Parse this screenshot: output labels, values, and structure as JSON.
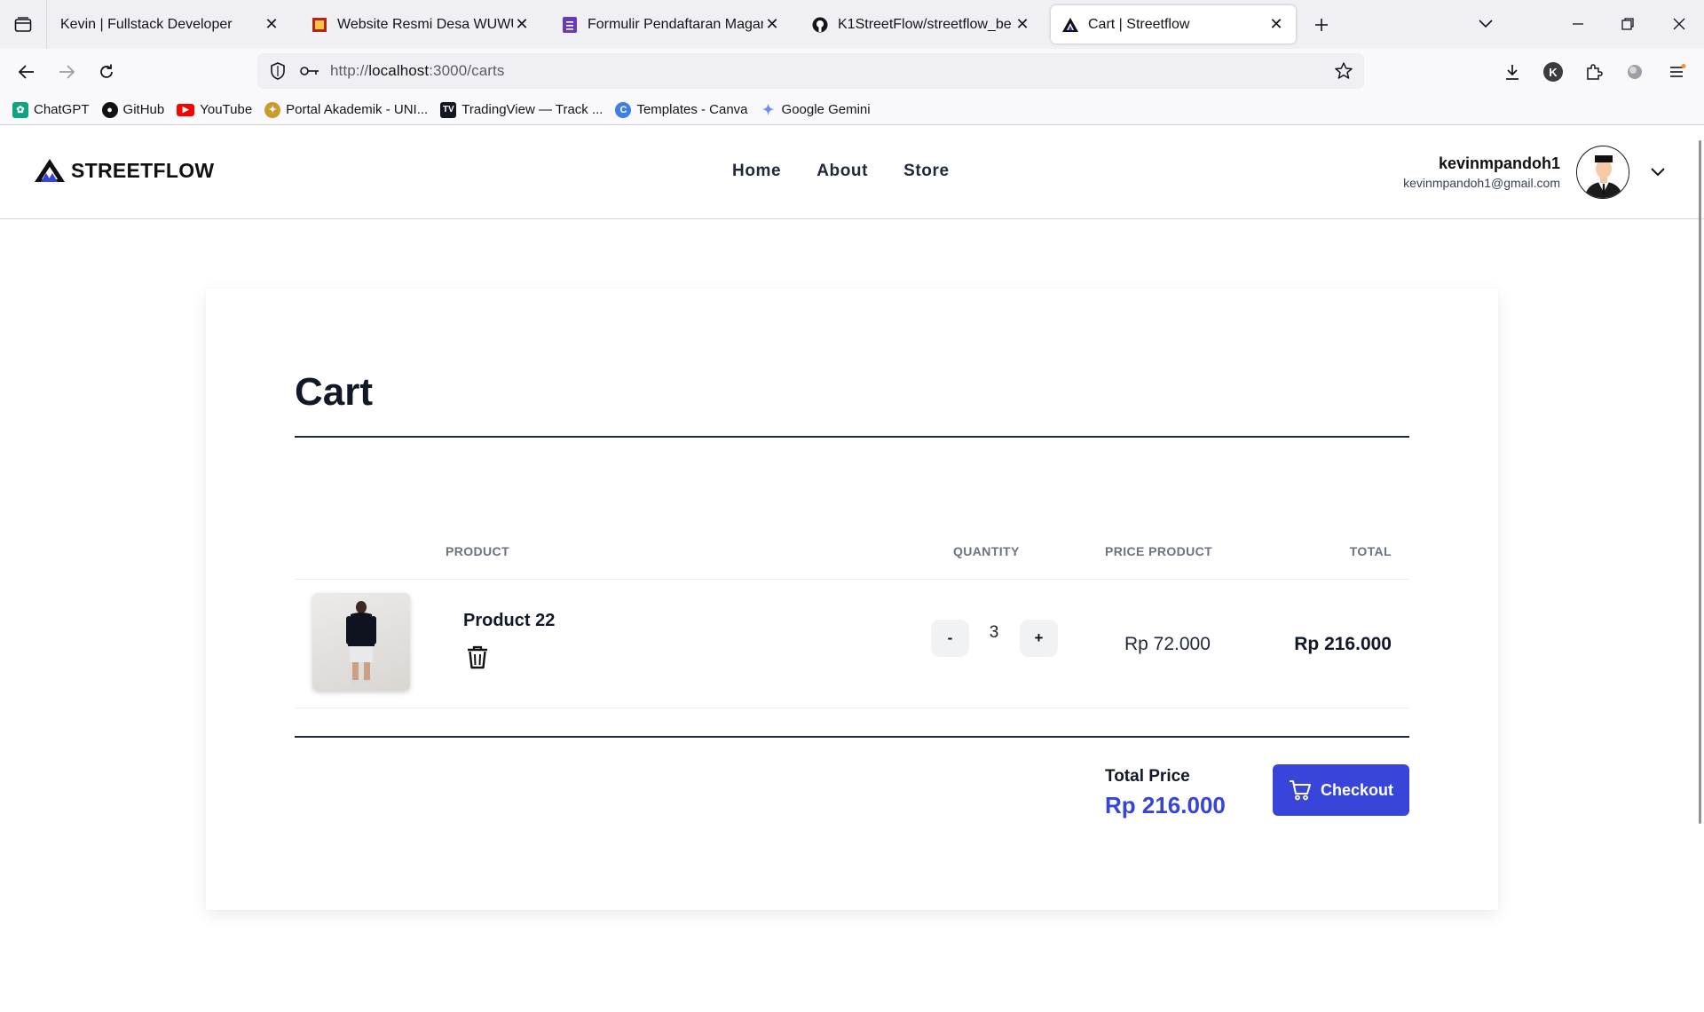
{
  "browser": {
    "tabs": [
      {
        "title": "Kevin | Fullstack Developer",
        "active": false
      },
      {
        "title": "Website Resmi Desa WUWUK",
        "active": false
      },
      {
        "title": "Formulir Pendaftaran Magang -",
        "active": false
      },
      {
        "title": "K1StreetFlow/streetflow_be",
        "active": false
      },
      {
        "title": "Cart | Streetflow",
        "active": true
      }
    ],
    "url": {
      "prefix": "http://",
      "host": "localhost",
      "suffix": ":3000/carts"
    },
    "bookmarks": [
      {
        "label": "ChatGPT",
        "icon": "chatgpt-icon",
        "color": "#10a37f"
      },
      {
        "label": "GitHub",
        "icon": "github-icon",
        "color": "#111111"
      },
      {
        "label": "YouTube",
        "icon": "youtube-icon",
        "color": "#ff0000"
      },
      {
        "label": "Portal Akademik - UNI...",
        "icon": "university-icon",
        "color": "#c89b2c"
      },
      {
        "label": "TradingView — Track ...",
        "icon": "tradingview-icon",
        "color": "#131722"
      },
      {
        "label": "Templates - Canva",
        "icon": "canva-icon",
        "color": "#3f7ee8"
      },
      {
        "label": "Google Gemini",
        "icon": "gemini-icon",
        "color": "#6f8cf2"
      }
    ],
    "profile_initial": "K"
  },
  "site": {
    "brand": "STREETFLOW",
    "nav": [
      "Home",
      "About",
      "Store"
    ],
    "user": {
      "name": "kevinmpandoh1",
      "email": "kevinmpandoh1@gmail.com"
    }
  },
  "cart": {
    "title": "Cart",
    "headers": {
      "product": "PRODUCT",
      "quantity": "QUANTITY",
      "price": "PRICE PRODUCT",
      "total": "TOTAL"
    },
    "items": [
      {
        "name": "Product 22",
        "quantity": "3",
        "price": "Rp 72.000",
        "total": "Rp 216.000"
      }
    ],
    "decrement_label": "-",
    "increment_label": "+",
    "total_label": "Total Price",
    "total_value": "Rp 216.000",
    "checkout_label": "Checkout"
  },
  "colors": {
    "accent": "#3845d8",
    "total_price": "#3545d6"
  }
}
